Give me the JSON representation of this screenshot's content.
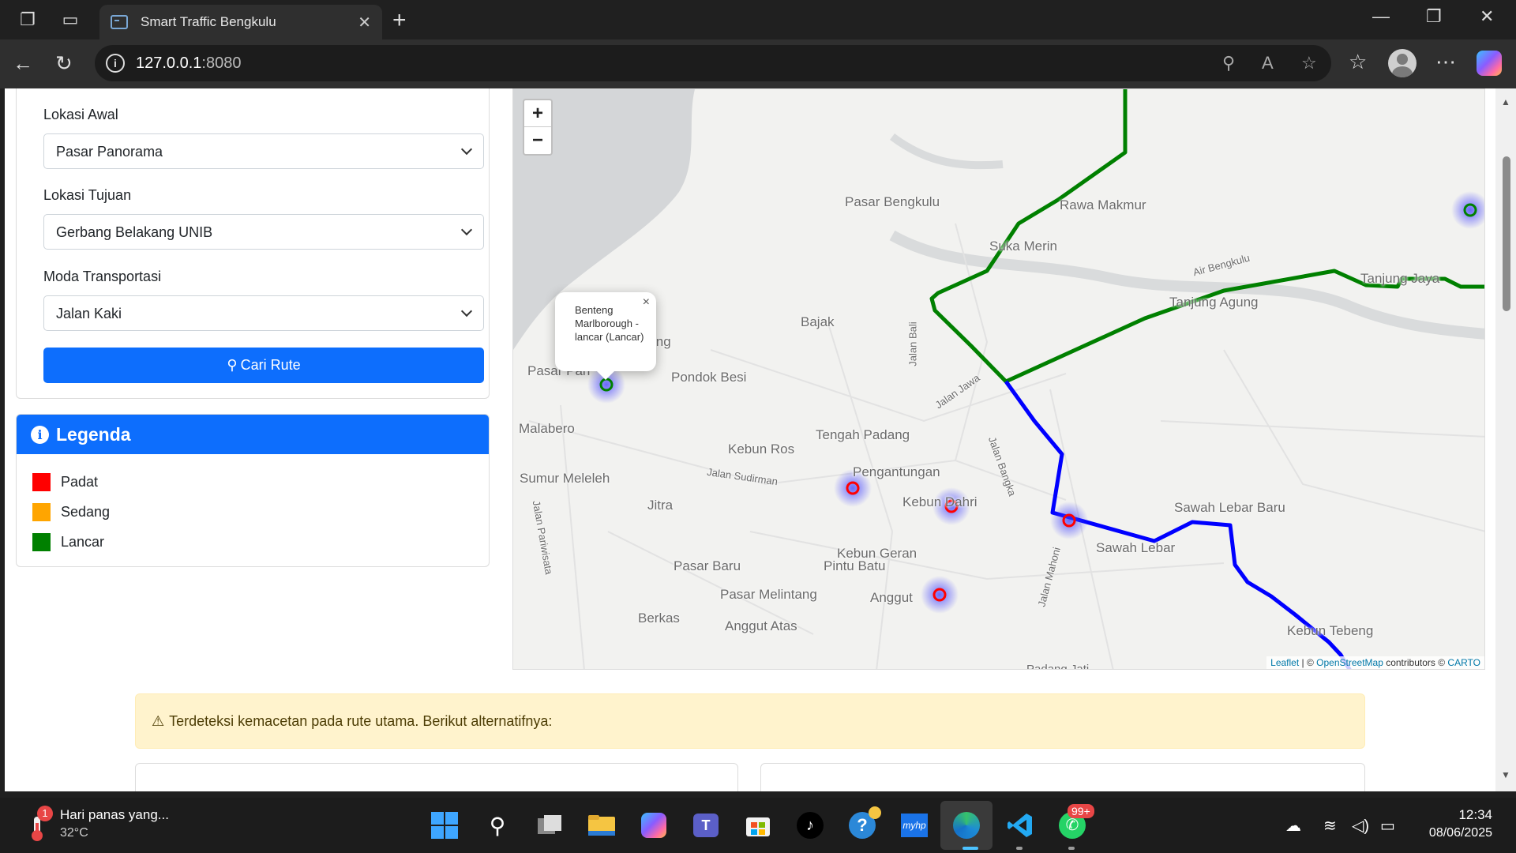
{
  "browser": {
    "tab_title": "Smart Traffic Bengkulu",
    "url_host": "127.0.0.1",
    "url_port": ":8080"
  },
  "form": {
    "start_label": "Lokasi Awal",
    "start_value": "Pasar Panorama",
    "dest_label": "Lokasi Tujuan",
    "dest_value": "Gerbang Belakang UNIB",
    "mode_label": "Moda Transportasi",
    "mode_value": "Jalan Kaki",
    "search_button": "Cari Rute"
  },
  "legend": {
    "title": "Legenda",
    "items": [
      {
        "label": "Padat",
        "color": "#ff0000"
      },
      {
        "label": "Sedang",
        "color": "#ffa500"
      },
      {
        "label": "Lancar",
        "color": "#008000"
      }
    ]
  },
  "map": {
    "zoom_in": "+",
    "zoom_out": "−",
    "popup_text": "Benteng Marlborough - lancar (Lancar)",
    "popup_close": "×",
    "attribution_leaflet": "Leaflet",
    "attribution_sep": " | © ",
    "attribution_osm": "OpenStreetMap",
    "attribution_mid": " contributors © ",
    "attribution_carto": "CARTO",
    "places": {
      "pasar_bengkulu": "Pasar Bengkulu",
      "rawa_makmur": "Rawa Makmur",
      "suka_merindu": "Suka Merin",
      "tanjung_jaya": "Tanjung Jaya",
      "tanjung_agung": "Tanjung Agung",
      "bajak": "Bajak",
      "ing": "ing",
      "pasar_pantai": "Pasar Pan",
      "pondok_besi": "Pondok Besi",
      "malabero": "Malabero",
      "tengah_padang": "Tengah Padang",
      "kebun_ros": "Kebun Ros",
      "sumur_meleleh": "Sumur Meleleh",
      "pengantungan": "Pengantungan",
      "kebun_dahri": "Kebun Dahri",
      "jitra": "Jitra",
      "sawah_lebar_baru": "Sawah Lebar Baru",
      "sawah_lebar": "Sawah Lebar",
      "kebun_geran": "Kebun Geran",
      "pintu_batu": "Pintu Batu",
      "pasar_baru": "Pasar Baru",
      "pasar_melintang": "Pasar Melintang",
      "anggut": "Anggut",
      "berkas": "Berkas",
      "anggut_atas": "Anggut Atas",
      "kebun_tebeng": "Kebun Tebeng",
      "padang_jati": "Padang Jati",
      "jalan_sudirman": "Jalan Sudirman",
      "jalan_jawa": "Jalan Jawa",
      "jalan_bangka": "Jalan Bangka",
      "jalan_bali": "Jalan Bali",
      "air_bengkulu": "Air Bengkulu",
      "jalan_pariwisata": "Jalan Pariwisata",
      "jalan_mahoni": "Jalan Mahoni"
    },
    "route_colors": {
      "green": "#008000",
      "blue": "#0000ff"
    }
  },
  "alert": {
    "text": "Terdeteksi kemacetan pada rute utama. Berikut alternatifnya:"
  },
  "taskbar": {
    "weather_title": "Hari panas yang...",
    "weather_temp": "32°C",
    "weather_badge": "1",
    "whatsapp_badge": "99+",
    "time": "12:34",
    "date": "08/06/2025"
  }
}
